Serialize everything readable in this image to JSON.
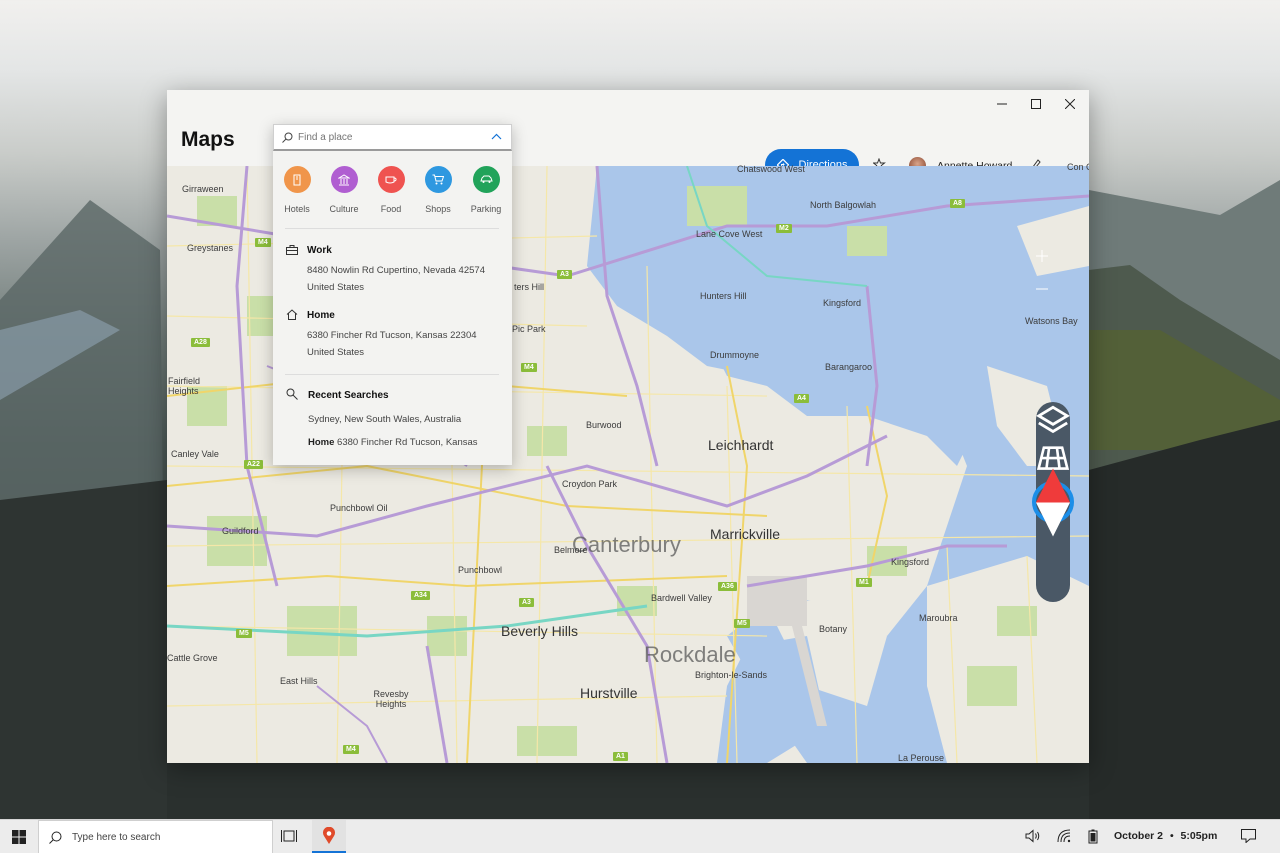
{
  "window": {
    "app_title": "Maps",
    "controls": {
      "minimize": "minimize-icon",
      "maximize": "maximize-icon",
      "close": "close-icon"
    }
  },
  "header": {
    "directions_label": "Directions",
    "user_name": "Annette Howard",
    "accent_color": "#1473d6"
  },
  "search": {
    "placeholder": "Find a place",
    "categories": [
      {
        "label": "Hotels",
        "icon": "hotel-icon",
        "color": "#f0954a"
      },
      {
        "label": "Culture",
        "icon": "culture-icon",
        "color": "#b05ed1"
      },
      {
        "label": "Food",
        "icon": "food-icon",
        "color": "#ef5350"
      },
      {
        "label": "Shops",
        "icon": "shops-icon",
        "color": "#2e98e0"
      },
      {
        "label": "Parking",
        "icon": "parking-icon",
        "color": "#21a35a"
      }
    ],
    "work": {
      "title": "Work",
      "line1": "8480 Nowlin Rd Cupertino, Nevada 42574",
      "line2": "United States"
    },
    "home": {
      "title": "Home",
      "line1": "6380 Fincher Rd Tucson, Kansas 22304",
      "line2": "United States"
    },
    "recent": {
      "title": "Recent Searches",
      "item1": "Sydney, New South Wales, Australia",
      "item2_label": "Home",
      "item2_text": "6380 Fincher Rd Tucson, Kansas"
    }
  },
  "map": {
    "labels": [
      "Chatswood West",
      "North Balgowlah",
      "Lane Cove West",
      "Hunters Hill",
      "Kingsford",
      "Drummoyne",
      "Barangaroo",
      "Watsons Bay",
      "Burwood",
      "Leichhardt",
      "Croydon Park",
      "Marrickville",
      "Canterbury",
      "Belmore",
      "Punchbowl",
      "Beverly Hills",
      "Rockdale",
      "Hurstville",
      "Brighton-le-Sands",
      "Botany",
      "Maroubra",
      "La Perouse",
      "Kingsford",
      "Bardwell Valley",
      "Girraween",
      "Greystanes",
      "Fairfield Heights",
      "Canley Vale",
      "Punchbowl Oil",
      "East Hills",
      "Revesby Heights",
      "Guildford",
      "Cattle Grove",
      "Pic Park",
      "ters Hill",
      "Con Cur"
    ],
    "shields": [
      "M4",
      "M2",
      "A8",
      "A3",
      "M4",
      "A4",
      "A22",
      "A28",
      "A34",
      "A3",
      "A36",
      "M1",
      "M5",
      "M5",
      "A1",
      "M4"
    ]
  },
  "map_controls": [
    "layers-icon",
    "3d-city-icon",
    "compass-icon",
    "zoom-in-icon",
    "zoom-out-icon"
  ],
  "taskbar": {
    "search_placeholder": "Type here to search",
    "date": "October 2",
    "time": "5:05pm"
  }
}
